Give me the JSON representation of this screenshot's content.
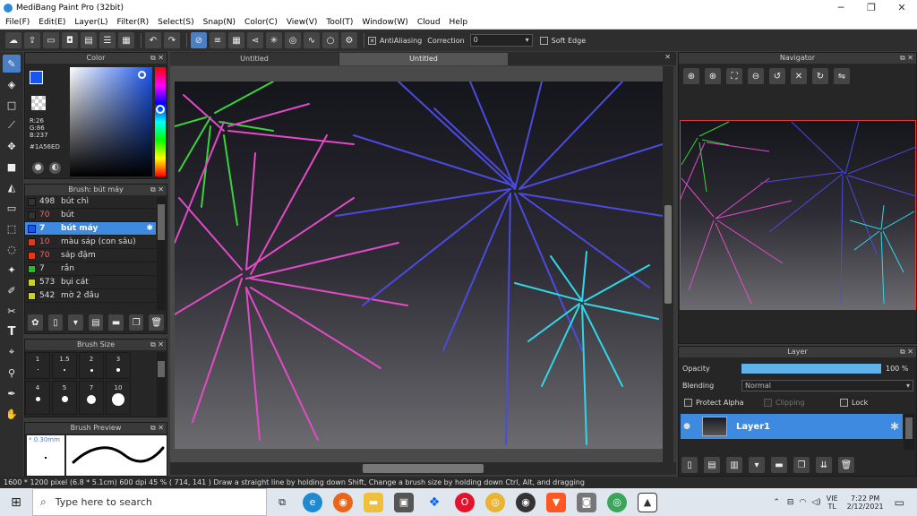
{
  "window": {
    "title": "MediBang Paint Pro (32bit)"
  },
  "menu": [
    "File(F)",
    "Edit(E)",
    "Layer(L)",
    "Filter(R)",
    "Select(S)",
    "Snap(N)",
    "Color(C)",
    "View(V)",
    "Tool(T)",
    "Window(W)",
    "Cloud",
    "Help"
  ],
  "toolbar": {
    "antialiasing_label": "AntiAliasing",
    "correction_label": "Correction",
    "correction_value": "0",
    "soft_edge_label": "Soft Edge"
  },
  "tabs": [
    "Untitled",
    "Untitled"
  ],
  "color_panel": {
    "title": "Color",
    "r": "R:26",
    "g": "G:86",
    "b": "B:237",
    "hex": "#1A56ED",
    "fg_color": "#1a56ed"
  },
  "brush_panel": {
    "title": "Brush: bút máy",
    "items": [
      {
        "num": "498",
        "name": "bút chì",
        "color": "#333333"
      },
      {
        "num": "70",
        "name": "bút",
        "color": "#333333"
      },
      {
        "num": "7",
        "name": "bút máy",
        "color": "#1a56ed",
        "selected": true
      },
      {
        "num": "10",
        "name": "màu sáp (con sâu)",
        "color": "#e03a1e"
      },
      {
        "num": "70",
        "name": "sáp đậm",
        "color": "#e03a1e"
      },
      {
        "num": "7",
        "name": "rắn",
        "color": "#2fb52f"
      },
      {
        "num": "573",
        "name": "bụi cát",
        "color": "#c8d22a"
      },
      {
        "num": "542",
        "name": "mờ 2 đầu",
        "color": "#c8d22a"
      }
    ]
  },
  "size_panel": {
    "title": "Brush Size",
    "sizes": [
      "1",
      "1.5",
      "2",
      "3",
      "4",
      "5",
      "7",
      "10"
    ]
  },
  "preview_panel": {
    "title": "Brush Preview",
    "size_label": "* 0.30mm"
  },
  "navigator": {
    "title": "Navigator"
  },
  "layer_panel": {
    "title": "Layer",
    "opacity_label": "Opacity",
    "opacity_value": "100 %",
    "opacity_fraction": 1.0,
    "blending_label": "Blending",
    "blending_value": "Normal",
    "protect_alpha": "Protect Alpha",
    "clipping": "Clipping",
    "lock": "Lock",
    "layer_name": "Layer1"
  },
  "status": {
    "text": "1600 * 1200 pixel   (6.8 * 5.1cm)   600 dpi   45 %   ( 714, 141 )   Draw a straight line by holding down Shift, Change a brush size by holding down Ctrl, Alt, and dragging"
  },
  "taskbar": {
    "search_placeholder": "Type here to search",
    "lang": "VIE",
    "lang2": "TL",
    "time": "7:22 PM",
    "date": "2/12/2021"
  },
  "colors": {
    "accent": "#3d8ae0",
    "panel_bg": "#262626",
    "canvas_top": "#15151c",
    "canvas_bottom": "#6b6b70"
  }
}
